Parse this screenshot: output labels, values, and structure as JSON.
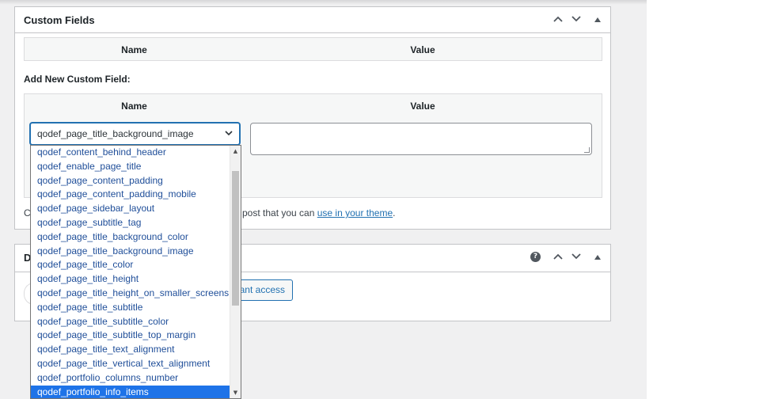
{
  "custom_fields_box": {
    "title": "Custom Fields",
    "table_head": {
      "name": "Name",
      "value": "Value"
    },
    "add_new_label": "Add New Custom Field:",
    "new_head": {
      "name": "Name",
      "value": "Value"
    },
    "select_value": "qodef_page_title_background_image",
    "description_prefix": "C",
    "description_mid": "post that you can ",
    "description_link": "use in your theme",
    "description_suffix": "."
  },
  "second_box": {
    "title_fragment": "D",
    "grant_button": "rant access"
  },
  "icons": {
    "move_up": "chevron-up-icon",
    "move_down": "chevron-down-icon",
    "toggle": "triangle-up-icon",
    "help": "help-icon"
  },
  "dropdown": {
    "options": [
      "qodef_content_behind_header",
      "qodef_enable_page_title",
      "qodef_page_content_padding",
      "qodef_page_content_padding_mobile",
      "qodef_page_sidebar_layout",
      "qodef_page_subtitle_tag",
      "qodef_page_title_background_color",
      "qodef_page_title_background_image",
      "qodef_page_title_color",
      "qodef_page_title_height",
      "qodef_page_title_height_on_smaller_screens",
      "qodef_page_title_subtitle",
      "qodef_page_title_subtitle_color",
      "qodef_page_title_subtitle_top_margin",
      "qodef_page_title_text_alignment",
      "qodef_page_title_vertical_text_alignment",
      "qodef_portfolio_columns_number",
      "qodef_portfolio_info_items"
    ],
    "highlighted": "qodef_portfolio_info_items"
  },
  "colors": {
    "accent": "#2271b1",
    "highlight": "#1e73e8",
    "option_text": "#1f4e99"
  }
}
